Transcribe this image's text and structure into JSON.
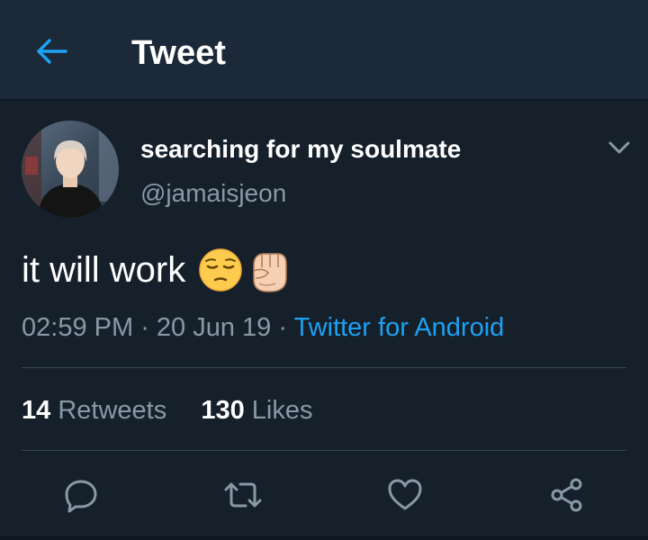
{
  "header": {
    "title": "Tweet",
    "back_icon": "arrow-left-icon"
  },
  "tweet": {
    "display_name": "searching for my soulmate",
    "handle": "@jamaisjeon",
    "text": "it will work",
    "emojis": [
      "pensive-face-emoji",
      "raised-fist-emoji"
    ],
    "time": "02:59 PM",
    "separator": " · ",
    "date": "20 Jun 19",
    "source": "Twitter for Android",
    "retweets_count": "14",
    "retweets_label": "Retweets",
    "likes_count": "130",
    "likes_label": "Likes"
  },
  "actions": {
    "icons": [
      "reply-icon",
      "retweet-icon",
      "like-icon",
      "share-icon"
    ]
  },
  "colors": {
    "background": "#15202b",
    "header": "#1c2938",
    "accent": "#1da1f2",
    "secondary_text": "#8899a6",
    "divider": "#38444d"
  }
}
